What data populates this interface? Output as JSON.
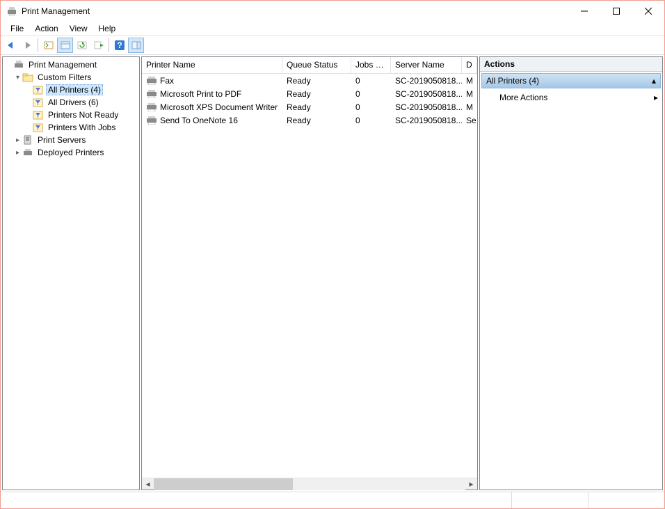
{
  "window": {
    "title": "Print Management"
  },
  "menu": {
    "file": "File",
    "action": "Action",
    "view": "View",
    "help": "Help"
  },
  "tree": {
    "root": "Print Management",
    "custom_filters": "Custom Filters",
    "all_printers": "All Printers (4)",
    "all_drivers": "All Drivers (6)",
    "printers_not_ready": "Printers Not Ready",
    "printers_with_jobs": "Printers With Jobs",
    "print_servers": "Print Servers",
    "deployed_printers": "Deployed Printers"
  },
  "columns": {
    "printer_name": "Printer Name",
    "queue_status": "Queue Status",
    "jobs_in": "Jobs In …",
    "server_name": "Server Name",
    "driver": "D"
  },
  "rows": [
    {
      "name": "Fax",
      "status": "Ready",
      "jobs": "0",
      "server": "SC-2019050818...",
      "drv": "M"
    },
    {
      "name": "Microsoft Print to PDF",
      "status": "Ready",
      "jobs": "0",
      "server": "SC-2019050818...",
      "drv": "M"
    },
    {
      "name": "Microsoft XPS Document Writer",
      "status": "Ready",
      "jobs": "0",
      "server": "SC-2019050818...",
      "drv": "M"
    },
    {
      "name": "Send To OneNote 16",
      "status": "Ready",
      "jobs": "0",
      "server": "SC-2019050818...",
      "drv": "Se"
    }
  ],
  "actions": {
    "title": "Actions",
    "section": "All Printers (4)",
    "more_actions": "More Actions"
  }
}
